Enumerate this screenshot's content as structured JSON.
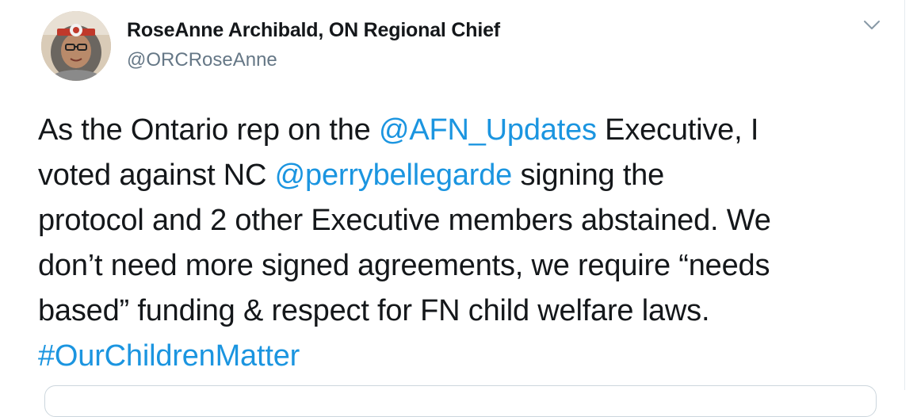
{
  "tweet": {
    "author": {
      "name": "RoseAnne Archibald, ON Regional Chief",
      "handle": "@ORCRoseAnne",
      "avatar_icon": "profile-photo"
    },
    "menu_icon": "chevron-down-icon",
    "body": {
      "line1_pre": "As the Ontario rep on the ",
      "mention1": "@AFN_Updates",
      "line1_post": " Executive, I",
      "line2_pre": "voted against NC ",
      "mention2": "@perrybellegarde",
      "line2_post": " signing the",
      "line3": "protocol and 2 other Executive members abstained. We",
      "line4": "don’t need more signed agreements, we require “needs",
      "line5": "based” funding & respect for FN child welfare laws.",
      "hashtag": "#OurChildrenMatter"
    }
  },
  "colors": {
    "link": "#1b95e0",
    "text": "#14171a",
    "secondary": "#657786"
  }
}
